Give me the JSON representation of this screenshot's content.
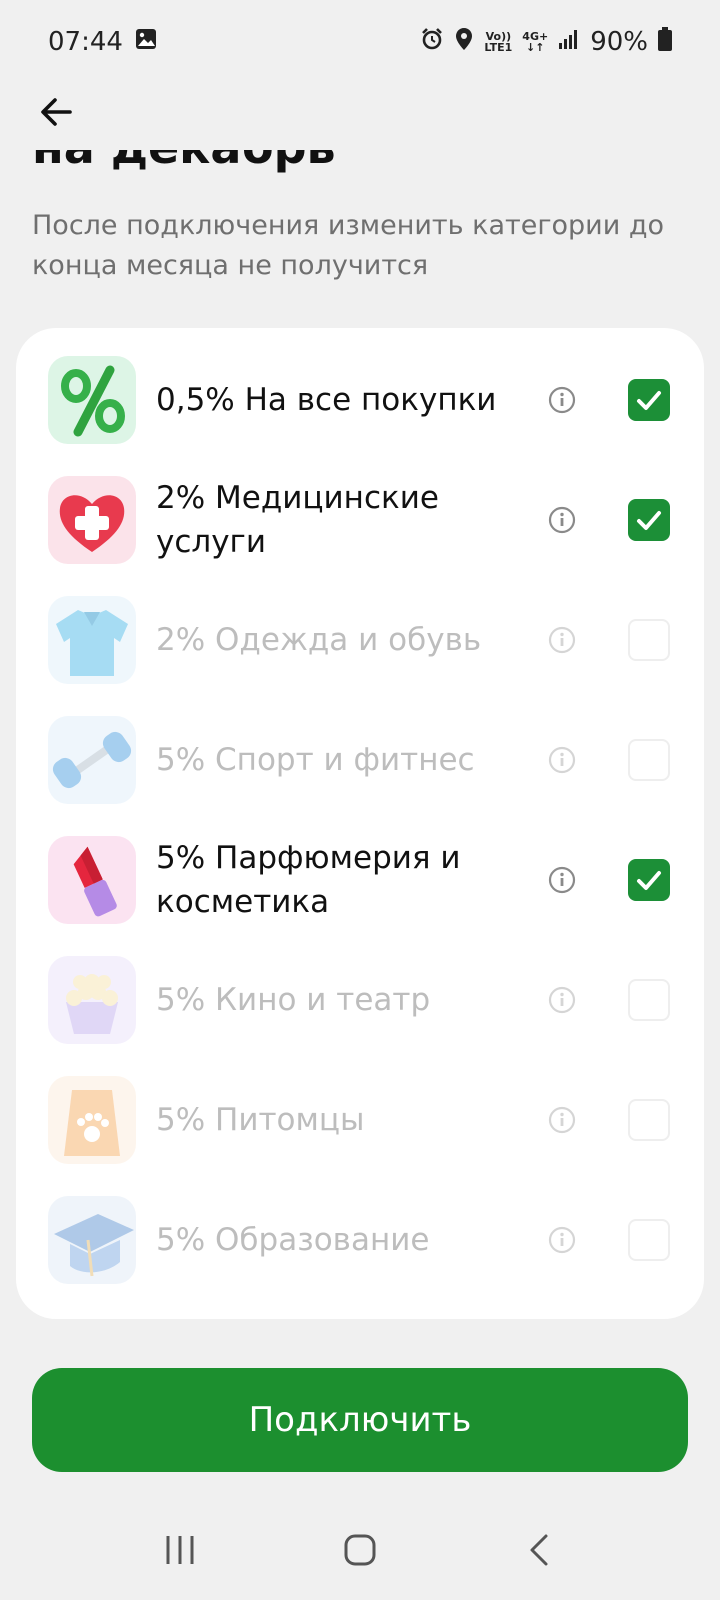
{
  "status_bar": {
    "time": "07:44",
    "network_top": "Vo))",
    "network_bottom": "LTE1",
    "data_type": "4G+",
    "battery_percent": "90%",
    "icons": [
      "image-icon",
      "alarm-icon",
      "location-icon",
      "volte-icon",
      "data-arrows-icon",
      "signal-icon",
      "battery-icon"
    ]
  },
  "header": {
    "back_icon": "arrow-left-icon",
    "title": "на декабрь",
    "subtitle": "После подключения изменить категории до конца месяца не получится"
  },
  "categories": [
    {
      "label": "0,5% На все покупки",
      "icon": "percent-icon",
      "checked": true,
      "enabled": true
    },
    {
      "label": "2% Медицинские услуги",
      "icon": "heart-medical-icon",
      "checked": true,
      "enabled": true
    },
    {
      "label": "2% Одежда и обувь",
      "icon": "polo-shirt-icon",
      "checked": false,
      "enabled": false
    },
    {
      "label": "5% Спорт и фитнес",
      "icon": "dumbbell-icon",
      "checked": false,
      "enabled": false
    },
    {
      "label": "5% Парфюмерия и косметика",
      "icon": "lipstick-icon",
      "checked": true,
      "enabled": true
    },
    {
      "label": "5% Кино и театр",
      "icon": "popcorn-icon",
      "checked": false,
      "enabled": false
    },
    {
      "label": "5% Питомцы",
      "icon": "pet-food-bag-icon",
      "checked": false,
      "enabled": false
    },
    {
      "label": "5% Образование",
      "icon": "graduation-cap-icon",
      "checked": false,
      "enabled": false
    }
  ],
  "actions": {
    "connect_label": "Подключить"
  },
  "colors": {
    "accent": "#1c8f2f",
    "background": "#f0f0f0",
    "card": "#ffffff",
    "disabled_text": "#bdbdbd",
    "subtitle": "#6f6f6f"
  },
  "nav_bar": {
    "icons": [
      "recent-apps-icon",
      "home-icon",
      "back-icon"
    ]
  }
}
